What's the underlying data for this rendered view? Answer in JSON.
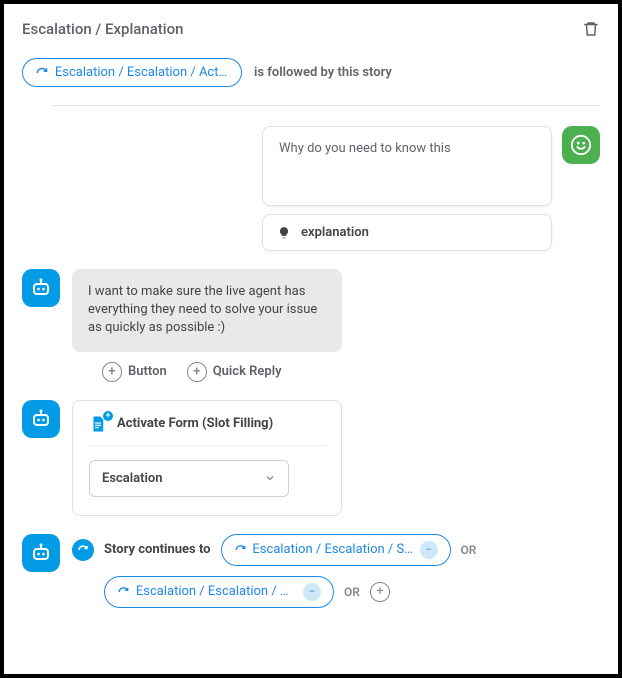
{
  "header": {
    "title": "Escalation / Explanation"
  },
  "preceding": {
    "chip_label": "Escalation / Escalation / Acti…",
    "followed_text": "is followed by this story"
  },
  "user": {
    "message": "Why do you need to know this",
    "intent_label": "explanation"
  },
  "bot": {
    "message": "I want to make sure the live agent has everything they need to solve your issue as quickly as possible :)"
  },
  "actions": {
    "button_label": "Button",
    "quick_reply_label": "Quick Reply"
  },
  "form": {
    "title": "Activate Form (Slot Filling)",
    "selected": "Escalation"
  },
  "continuation": {
    "label": "Story continues to",
    "chips": [
      "Escalation / Escalation / Sub…",
      "Escalation / Escalation / Can…"
    ],
    "or_label": "OR"
  }
}
